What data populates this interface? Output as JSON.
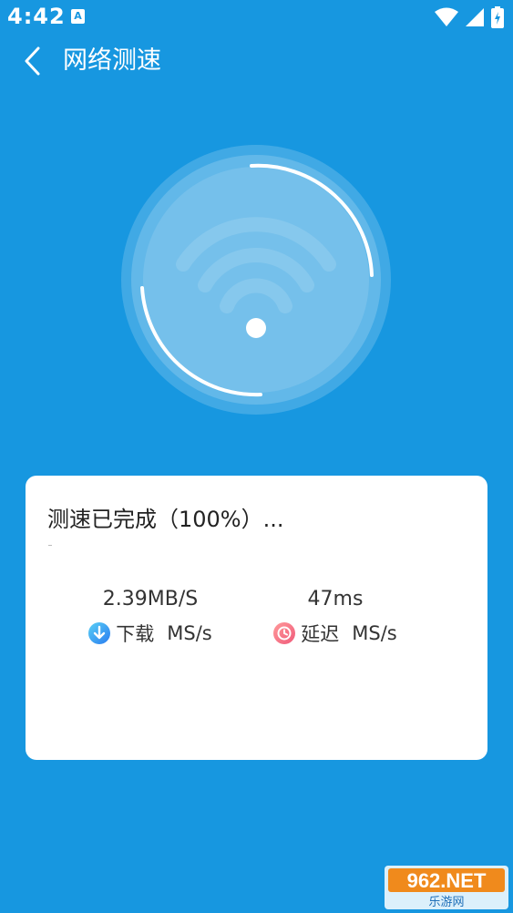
{
  "status_bar": {
    "time": "4:42",
    "app_icon_letter": "A"
  },
  "header": {
    "title": "网络测速"
  },
  "gauge": {
    "progress_percent": 100
  },
  "card": {
    "status": "测速已完成（100%）...",
    "download": {
      "value": "2.39MB/S",
      "label": "下载",
      "unit": "MS/s"
    },
    "latency": {
      "value": "47ms",
      "label": "延迟",
      "unit": "MS/s"
    }
  },
  "watermark": {
    "top": "962.NET",
    "bottom": "乐游网"
  },
  "colors": {
    "background": "#1797e0",
    "card": "#ffffff",
    "download_icon": "#2a7cf0",
    "latency_icon": "#f05a7a"
  }
}
